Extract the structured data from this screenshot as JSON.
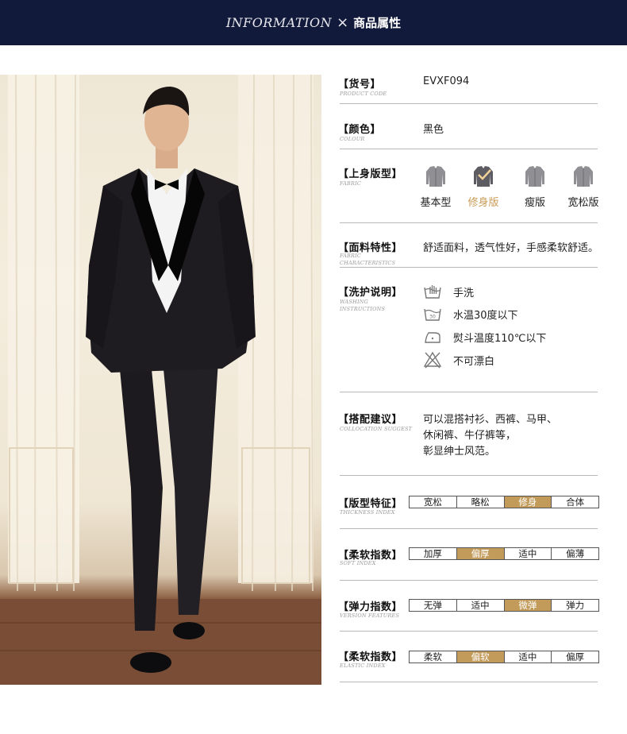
{
  "header": {
    "en": "INFORMATION",
    "sep": "×",
    "cn": "商品属性"
  },
  "rows": {
    "code": {
      "title": "【货号】",
      "sub": "PRODUCT CODE",
      "value": "EVXF094"
    },
    "color": {
      "title": "【颜色】",
      "sub": "COLOUR",
      "value": "黑色"
    },
    "fit": {
      "title": "【上身版型】",
      "sub": "FABRIC",
      "options": [
        "基本型",
        "修身版",
        "瘦版",
        "宽松版"
      ],
      "active_index": 1
    },
    "fabric": {
      "title": "【面料特性】",
      "sub": "FABRIC CHARACTERISTICS",
      "value": "舒适面料，透气性好，手感柔软舒适。"
    },
    "care": {
      "title": "【洗护说明】",
      "sub": "WASHING INSTRUCTIONS",
      "items": [
        {
          "icon": "hand-wash-icon",
          "text": "手洗"
        },
        {
          "icon": "wash-30-icon",
          "icon_text": "30",
          "text": "水温30度以下"
        },
        {
          "icon": "iron-icon",
          "text": "熨斗温度110℃以下"
        },
        {
          "icon": "no-bleach-icon",
          "text": "不可漂白"
        }
      ]
    },
    "collocation": {
      "title": "【搭配建议】",
      "sub": "COLLOCATION SUGGEST",
      "lines": [
        "可以混搭衬衫、西裤、马甲、",
        "休闲裤、牛仔裤等，",
        "彰显绅士风范。"
      ]
    },
    "thickness": {
      "title": "【版型特征】",
      "sub": "THICKNESS INDEX",
      "cells": [
        "宽松",
        "略松",
        "修身",
        "合体"
      ],
      "active_index": 2
    },
    "soft": {
      "title": "【柔软指数】",
      "sub": "SOFT INDEX",
      "cells": [
        "加厚",
        "偏厚",
        "适中",
        "偏薄"
      ],
      "active_index": 1
    },
    "elastic": {
      "title": "【弹力指数】",
      "sub": "VERSION FEATURES",
      "cells": [
        "无弹",
        "适中",
        "微弹",
        "弹力"
      ],
      "active_index": 2
    },
    "soft2": {
      "title": "【柔软指数】",
      "sub": "ELASTIC INDEX",
      "cells": [
        "柔软",
        "偏软",
        "适中",
        "偏厚"
      ],
      "active_index": 1
    }
  },
  "colors": {
    "header_bg": "#111a3a",
    "accent": "#c29a5a",
    "accent_text": "#c99a55",
    "suit": "#1e1c20"
  }
}
